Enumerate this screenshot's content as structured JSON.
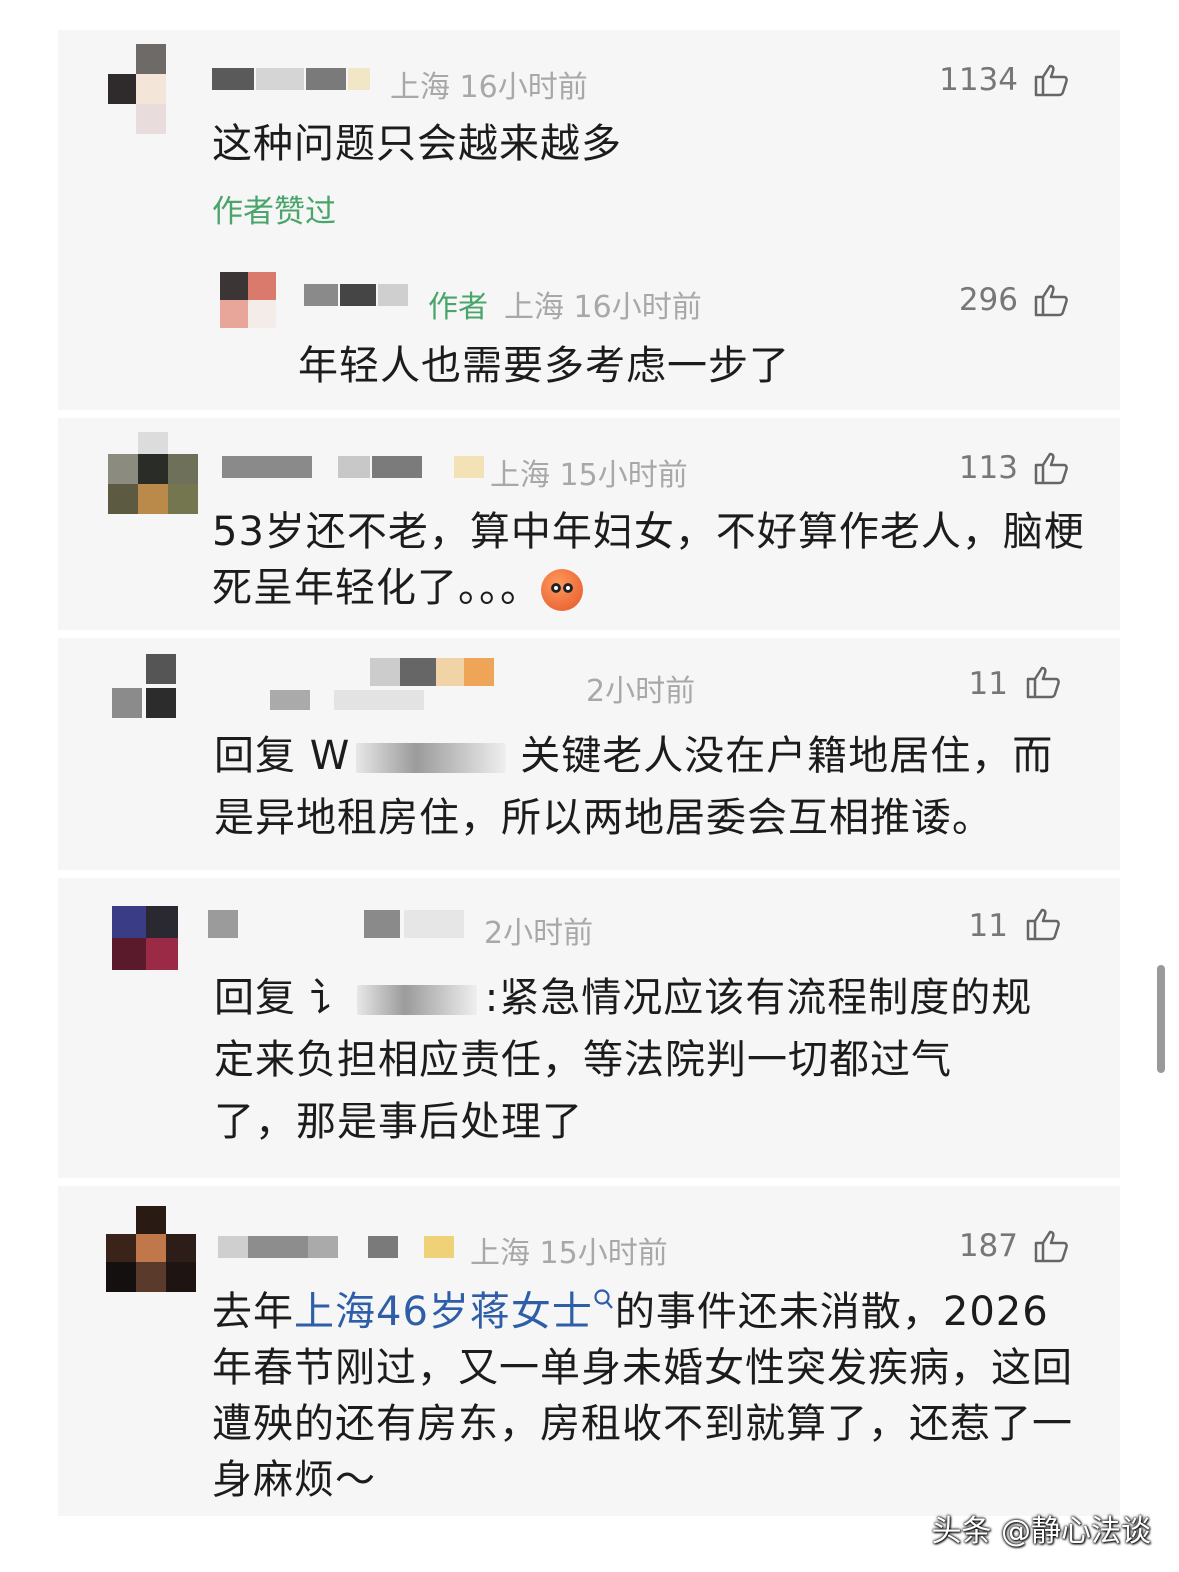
{
  "comments": [
    {
      "location_time": "上海 16小时前",
      "likes": "1134",
      "text": "这种问题只会越来越多",
      "author_liked": "作者赞过",
      "reply": {
        "author_tag": "作者",
        "location_time": "上海 16小时前",
        "likes": "296",
        "text": "年轻人也需要多考虑一步了"
      }
    },
    {
      "location_time": "上海 15小时前",
      "likes": "113",
      "text_line1": "53岁还不老，算中年妇女，不好算作老人，脑梗",
      "text_line2": "死呈年轻化了。。。"
    },
    {
      "location_time": "2小时前",
      "likes": "11",
      "reply_prefix": "回复 W",
      "text_line1_rest": "关键老人没在户籍地居住，而",
      "text_line2": "是异地租房住，所以两地居委会互相推诿。"
    },
    {
      "location_time": "2小时前",
      "likes": "11",
      "reply_prefix": "回复 讠",
      "text_line1_rest": ":紧急情况应该有流程制度的规",
      "text_line2": "定来负担相应责任，等法院判一切都过气",
      "text_line3": "了，那是事后处理了"
    },
    {
      "location_time": "上海 15小时前",
      "likes": "187",
      "text_pre": "去年",
      "link": "上海46岁蒋女士",
      "text_post": "的事件还未消散，2026",
      "text_line2": "年春节刚过，又一单身未婚女性突发疾病，这回",
      "text_line3": "遭殃的还有房东，房租收不到就算了，还惹了一",
      "text_line4": "身麻烦～"
    }
  ],
  "watermark": "头条 @静心法谈",
  "colors": {
    "green": "#4aa56a",
    "link": "#2f5ea8",
    "meta": "#a8a8a8"
  },
  "icons": {
    "like": "thumbs-up-icon",
    "search": "search-icon"
  }
}
